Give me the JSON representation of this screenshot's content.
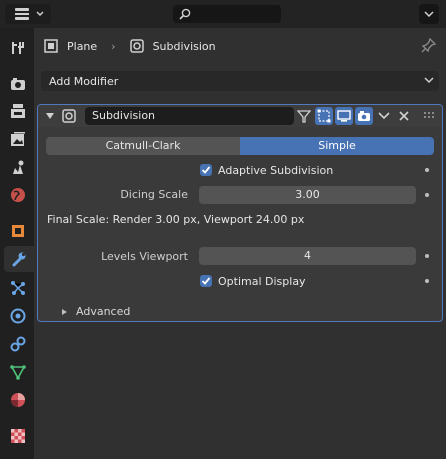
{
  "breadcrumb": {
    "object": "Plane",
    "modifier": "Subdivision"
  },
  "add_modifier": {
    "label": "Add Modifier"
  },
  "modifier": {
    "name": "Subdivision",
    "types": [
      "Catmull-Clark",
      "Simple"
    ],
    "selected_type": "Simple",
    "adaptive_subdivision": {
      "label": "Adaptive Subdivision",
      "checked": true
    },
    "dicing_scale": {
      "label": "Dicing Scale",
      "value": "3.00"
    },
    "final_scale": "Final Scale: Render 3.00 px, Viewport 24.00 px",
    "levels_viewport": {
      "label": "Levels Viewport",
      "value": "4"
    },
    "optimal_display": {
      "label": "Optimal Display",
      "checked": true
    },
    "advanced": {
      "label": "Advanced"
    }
  },
  "colors": {
    "accent": "#4772b3",
    "panel": "#3a3a3a",
    "border_active": "#5079c0"
  },
  "tabs": [
    "tool-icon",
    "render-icon",
    "output-icon",
    "view-layer-icon",
    "scene-icon",
    "world-icon",
    "object-icon",
    "modifier-icon",
    "particles-icon",
    "physics-icon",
    "constraints-icon",
    "data-icon",
    "material-icon",
    "texture-icon"
  ]
}
